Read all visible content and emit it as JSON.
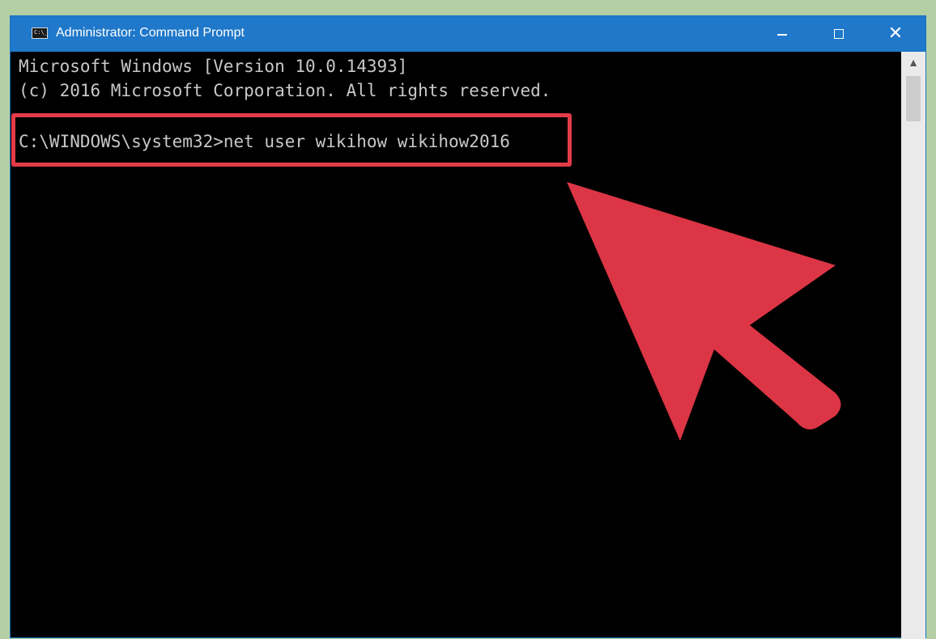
{
  "window": {
    "title": "Administrator: Command Prompt",
    "icon": "cmd-icon",
    "icon_text": "C:\\_",
    "controls": [
      "minimize-icon",
      "maximize-icon",
      "close-icon"
    ]
  },
  "console": {
    "lines": [
      "Microsoft Windows [Version 10.0.14393]",
      "(c) 2016 Microsoft Corporation. All rights reserved.",
      "C:\\WINDOWS\\system32>net user wikihow wikihow2016"
    ]
  },
  "annotations": {
    "highlight_color": "#e33b49",
    "arrow_color": "#dc3545"
  }
}
